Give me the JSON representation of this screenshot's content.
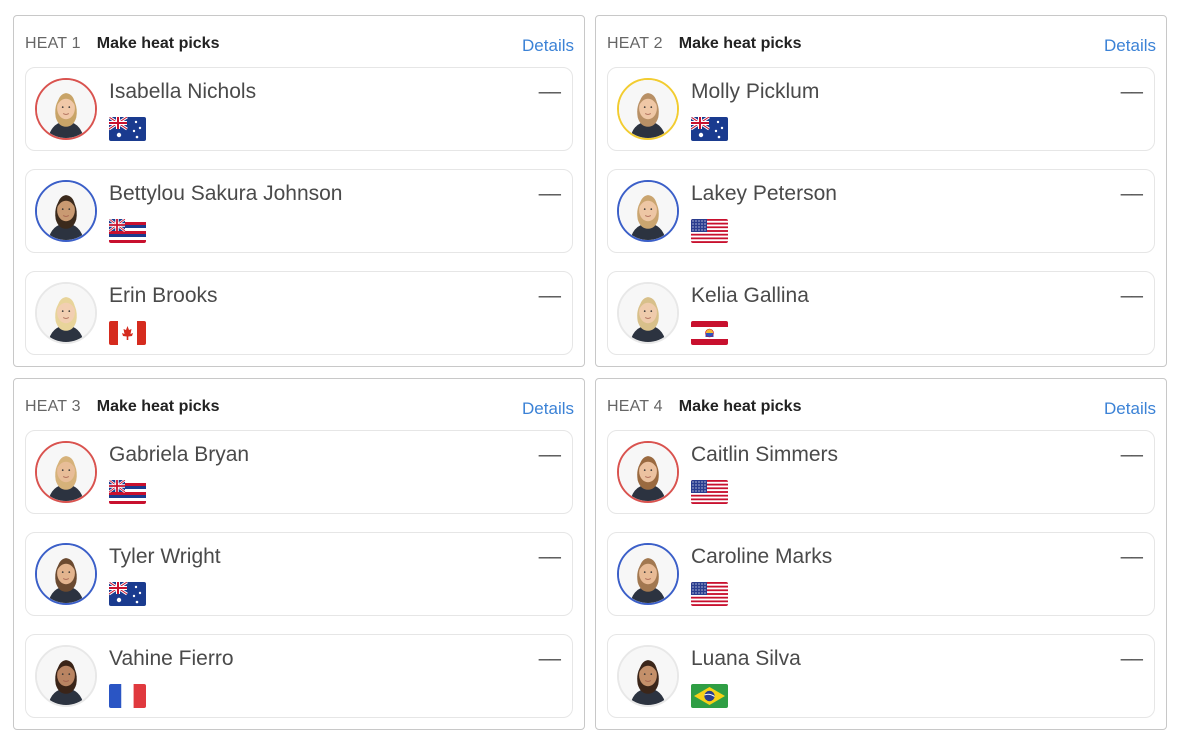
{
  "heats": [
    {
      "label": "HEAT 1",
      "cta": "Make heat picks",
      "details": "Details",
      "surfers": [
        {
          "name": "Isabella Nichols",
          "score": "––",
          "flag": "AU",
          "ring": "#d9534f",
          "hair": "#c8a468",
          "skin": "#f0c8a8"
        },
        {
          "name": "Bettylou Sakura Johnson",
          "score": "––",
          "flag": "HI",
          "ring": "#3b5fc8",
          "hair": "#3b2a1c",
          "skin": "#c99a72"
        },
        {
          "name": "Erin Brooks",
          "score": "––",
          "flag": "CA",
          "ring": "#e8e8e8",
          "hair": "#e8d49a",
          "skin": "#f2cfb2"
        }
      ]
    },
    {
      "label": "HEAT 2",
      "cta": "Make heat picks",
      "details": "Details",
      "surfers": [
        {
          "name": "Molly Picklum",
          "score": "––",
          "flag": "AU",
          "ring": "#f2cc30",
          "hair": "#b89066",
          "skin": "#efc7a6"
        },
        {
          "name": "Lakey Peterson",
          "score": "––",
          "flag": "US",
          "ring": "#3b5fc8",
          "hair": "#caa570",
          "skin": "#eec6a4"
        },
        {
          "name": "Kelia Gallina",
          "score": "––",
          "flag": "PF",
          "ring": "#e8e8e8",
          "hair": "#d8c08a",
          "skin": "#efcbac"
        }
      ]
    },
    {
      "label": "HEAT 3",
      "cta": "Make heat picks",
      "details": "Details",
      "surfers": [
        {
          "name": "Gabriela Bryan",
          "score": "––",
          "flag": "HI",
          "ring": "#d9534f",
          "hair": "#d6b27a",
          "skin": "#e8bd98"
        },
        {
          "name": "Tyler Wright",
          "score": "––",
          "flag": "AU",
          "ring": "#3b5fc8",
          "hair": "#6b4a30",
          "skin": "#e3b48e"
        },
        {
          "name": "Vahine Fierro",
          "score": "––",
          "flag": "FR",
          "ring": "#e8e8e8",
          "hair": "#3a2418",
          "skin": "#b98462"
        }
      ]
    },
    {
      "label": "HEAT 4",
      "cta": "Make heat picks",
      "details": "Details",
      "surfers": [
        {
          "name": "Caitlin Simmers",
          "score": "––",
          "flag": "US",
          "ring": "#d9534f",
          "hair": "#9a6a40",
          "skin": "#ecc2a0"
        },
        {
          "name": "Caroline Marks",
          "score": "––",
          "flag": "US",
          "ring": "#3b5fc8",
          "hair": "#a27850",
          "skin": "#e8bb96"
        },
        {
          "name": "Luana Silva",
          "score": "––",
          "flag": "BR",
          "ring": "#e8e8e8",
          "hair": "#3b261a",
          "skin": "#c4906a"
        }
      ]
    }
  ],
  "colors": {
    "link": "#3b82d6",
    "border": "#c8c8c8",
    "card_border": "#e6e6e6"
  }
}
